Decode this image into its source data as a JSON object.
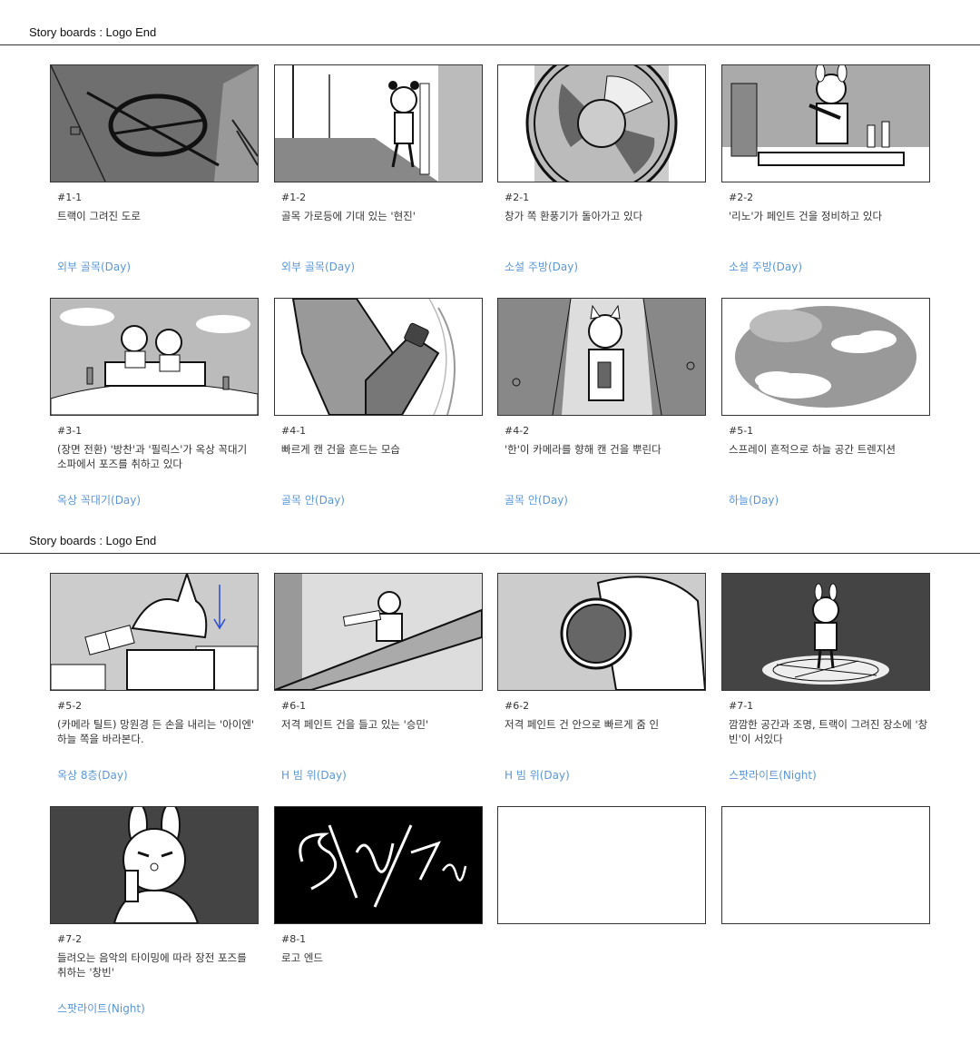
{
  "sections": [
    {
      "title": "Story boards : Logo End"
    },
    {
      "title": "Story boards : Logo End"
    }
  ],
  "cards": [
    {
      "shot": "#1-1",
      "desc": "트랙이 그려진 도로",
      "loc": "외부 골목(Day)"
    },
    {
      "shot": "#1-2",
      "desc": "골목 가로등에 기대 있는 '현진'",
      "loc": "외부 골목(Day)"
    },
    {
      "shot": "#2-1",
      "desc": "창가 쪽 환풍기가 돌아가고 있다",
      "loc": "소설 주방(Day)"
    },
    {
      "shot": "#2-2",
      "desc": "'리노'가 페인트 건을 정비하고 있다",
      "loc": "소설 주방(Day)"
    },
    {
      "shot": "#3-1",
      "desc": "(장면 전환) '방찬'과 '필릭스'가 옥상 꼭대기 소파에서 포즈를 취하고 있다",
      "loc": "옥상 꼭대기(Day)"
    },
    {
      "shot": "#4-1",
      "desc": "빠르게 캔 건을 흔드는 모습",
      "loc": "골목 안(Day)"
    },
    {
      "shot": "#4-2",
      "desc": "'한'이 카메라를 향해 캔 건을 뿌린다",
      "loc": "골목 안(Day)"
    },
    {
      "shot": "#5-1",
      "desc": "스프레이 흔적으로 하늘 공간 트렌지션",
      "loc": "하늘(Day)"
    },
    {
      "shot": "#5-2",
      "desc": "(카메라 틸트) 망원경 든 손을 내리는 '아이엔' 하늘 쪽을 바라본다.",
      "loc": "옥상 8층(Day)"
    },
    {
      "shot": "#6-1",
      "desc": "저격 페인트 건을 들고 있는 '승민'",
      "loc": "H 빔 위(Day)"
    },
    {
      "shot": "#6-2",
      "desc": "저격 페인트 건 안으로 빠르게 줌 인",
      "loc": "H 빔 위(Day)"
    },
    {
      "shot": "#7-1",
      "desc": "깜깜한 공간과 조명, 트랙이 그려진 장소에 '창빈'이 서있다",
      "loc": "스팟라이트(Night)"
    },
    {
      "shot": "#7-2",
      "desc": "들려오는 음악의 타이밍에 따라 장전 포즈를 취하는 '창빈'",
      "loc": "스팟라이트(Night)"
    },
    {
      "shot": "#8-1",
      "desc": "로고 엔드",
      "loc": ""
    }
  ],
  "logo_text": "Stray Kids",
  "colors": {
    "location_text": "#5b97d8",
    "frame_border": "#333333",
    "dark_panel": "#444444",
    "logo_bg": "#000000"
  }
}
